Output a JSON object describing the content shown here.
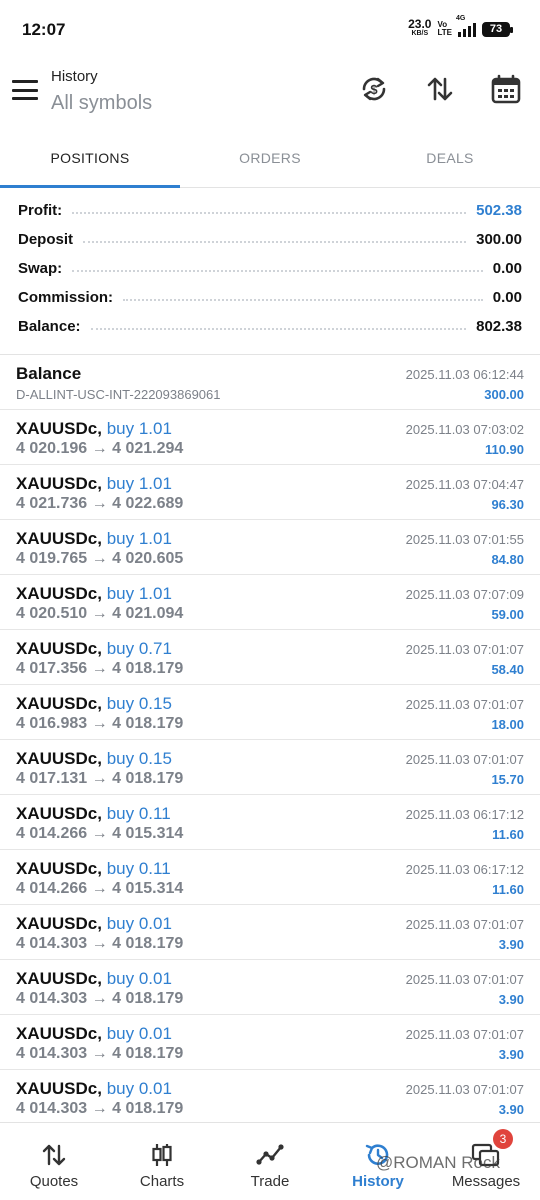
{
  "status_bar": {
    "time": "12:07",
    "net_speed_value": "23.0",
    "net_speed_unit": "KB/S",
    "volte_top": "Vo",
    "volte_bottom": "LTE",
    "signal_label": "4G",
    "battery": "73"
  },
  "header": {
    "title": "History",
    "subtitle": "All symbols"
  },
  "tabs": [
    {
      "label": "POSITIONS",
      "active": true
    },
    {
      "label": "ORDERS",
      "active": false
    },
    {
      "label": "DEALS",
      "active": false
    }
  ],
  "summary": [
    {
      "label": "Profit:",
      "value": "502.38",
      "highlight": true
    },
    {
      "label": "Deposit",
      "value": "300.00",
      "highlight": false
    },
    {
      "label": "Swap:",
      "value": "0.00",
      "highlight": false
    },
    {
      "label": "Commission:",
      "value": "0.00",
      "highlight": false
    },
    {
      "label": "Balance:",
      "value": "802.38",
      "highlight": false
    }
  ],
  "balance_entry": {
    "title": "Balance",
    "account": "D-ALLINT-USC-INT-222093869061",
    "time": "2025.11.03 06:12:44",
    "amount": "300.00"
  },
  "positions": [
    {
      "symbol": "XAUUSDc,",
      "side": "buy 1.01",
      "open": "4 020.196",
      "close": "4 021.294",
      "time": "2025.11.03 07:03:02",
      "profit": "110.90"
    },
    {
      "symbol": "XAUUSDc,",
      "side": "buy 1.01",
      "open": "4 021.736",
      "close": "4 022.689",
      "time": "2025.11.03 07:04:47",
      "profit": "96.30"
    },
    {
      "symbol": "XAUUSDc,",
      "side": "buy 1.01",
      "open": "4 019.765",
      "close": "4 020.605",
      "time": "2025.11.03 07:01:55",
      "profit": "84.80"
    },
    {
      "symbol": "XAUUSDc,",
      "side": "buy 1.01",
      "open": "4 020.510",
      "close": "4 021.094",
      "time": "2025.11.03 07:07:09",
      "profit": "59.00"
    },
    {
      "symbol": "XAUUSDc,",
      "side": "buy 0.71",
      "open": "4 017.356",
      "close": "4 018.179",
      "time": "2025.11.03 07:01:07",
      "profit": "58.40"
    },
    {
      "symbol": "XAUUSDc,",
      "side": "buy 0.15",
      "open": "4 016.983",
      "close": "4 018.179",
      "time": "2025.11.03 07:01:07",
      "profit": "18.00"
    },
    {
      "symbol": "XAUUSDc,",
      "side": "buy 0.15",
      "open": "4 017.131",
      "close": "4 018.179",
      "time": "2025.11.03 07:01:07",
      "profit": "15.70"
    },
    {
      "symbol": "XAUUSDc,",
      "side": "buy 0.11",
      "open": "4 014.266",
      "close": "4 015.314",
      "time": "2025.11.03 06:17:12",
      "profit": "11.60"
    },
    {
      "symbol": "XAUUSDc,",
      "side": "buy 0.11",
      "open": "4 014.266",
      "close": "4 015.314",
      "time": "2025.11.03 06:17:12",
      "profit": "11.60"
    },
    {
      "symbol": "XAUUSDc,",
      "side": "buy 0.01",
      "open": "4 014.303",
      "close": "4 018.179",
      "time": "2025.11.03 07:01:07",
      "profit": "3.90"
    },
    {
      "symbol": "XAUUSDc,",
      "side": "buy 0.01",
      "open": "4 014.303",
      "close": "4 018.179",
      "time": "2025.11.03 07:01:07",
      "profit": "3.90"
    },
    {
      "symbol": "XAUUSDc,",
      "side": "buy 0.01",
      "open": "4 014.303",
      "close": "4 018.179",
      "time": "2025.11.03 07:01:07",
      "profit": "3.90"
    },
    {
      "symbol": "XAUUSDc,",
      "side": "buy 0.01",
      "open": "4 014.303",
      "close": "4 018.179",
      "time": "2025.11.03 07:01:07",
      "profit": "3.90"
    }
  ],
  "arrow": "→",
  "bottom_nav": [
    {
      "label": "Quotes",
      "icon": "quotes-arrows-icon",
      "active": false
    },
    {
      "label": "Charts",
      "icon": "candlestick-icon",
      "active": false
    },
    {
      "label": "Trade",
      "icon": "trade-line-icon",
      "active": false
    },
    {
      "label": "History",
      "icon": "history-clock-icon",
      "active": true
    },
    {
      "label": "Messages",
      "icon": "messages-icon",
      "active": false,
      "badge": "3"
    }
  ],
  "watermark": "@ROMAN Rock",
  "colors": {
    "accent": "#2f7fd0",
    "badge": "#e0443c",
    "muted": "#7c8189"
  }
}
